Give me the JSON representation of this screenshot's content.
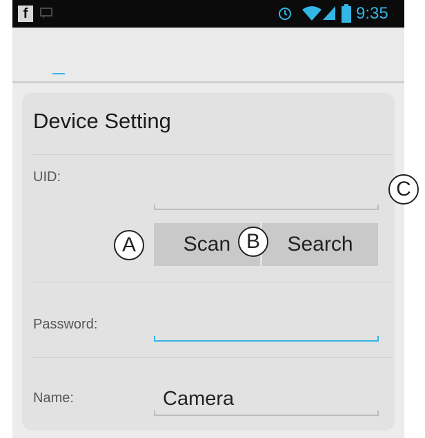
{
  "status_bar": {
    "app_icon": "f",
    "time": "9:35",
    "icons": [
      "facebook-icon",
      "message-icon",
      "alarm-icon",
      "wifi-icon",
      "signal-icon",
      "battery-icon"
    ]
  },
  "card": {
    "title": "Device Setting",
    "uid": {
      "label": "UID:",
      "value": ""
    },
    "buttons": {
      "scan": "Scan",
      "search": "Search"
    },
    "password": {
      "label": "Password:",
      "value": ""
    },
    "name": {
      "label": "Name:",
      "value": "Camera"
    }
  },
  "callouts": {
    "a": "A",
    "b": "B",
    "c": "C"
  },
  "colors": {
    "accent": "#33b5e5",
    "status_bar": "#0b0b0b",
    "button": "#c9c9c9"
  }
}
